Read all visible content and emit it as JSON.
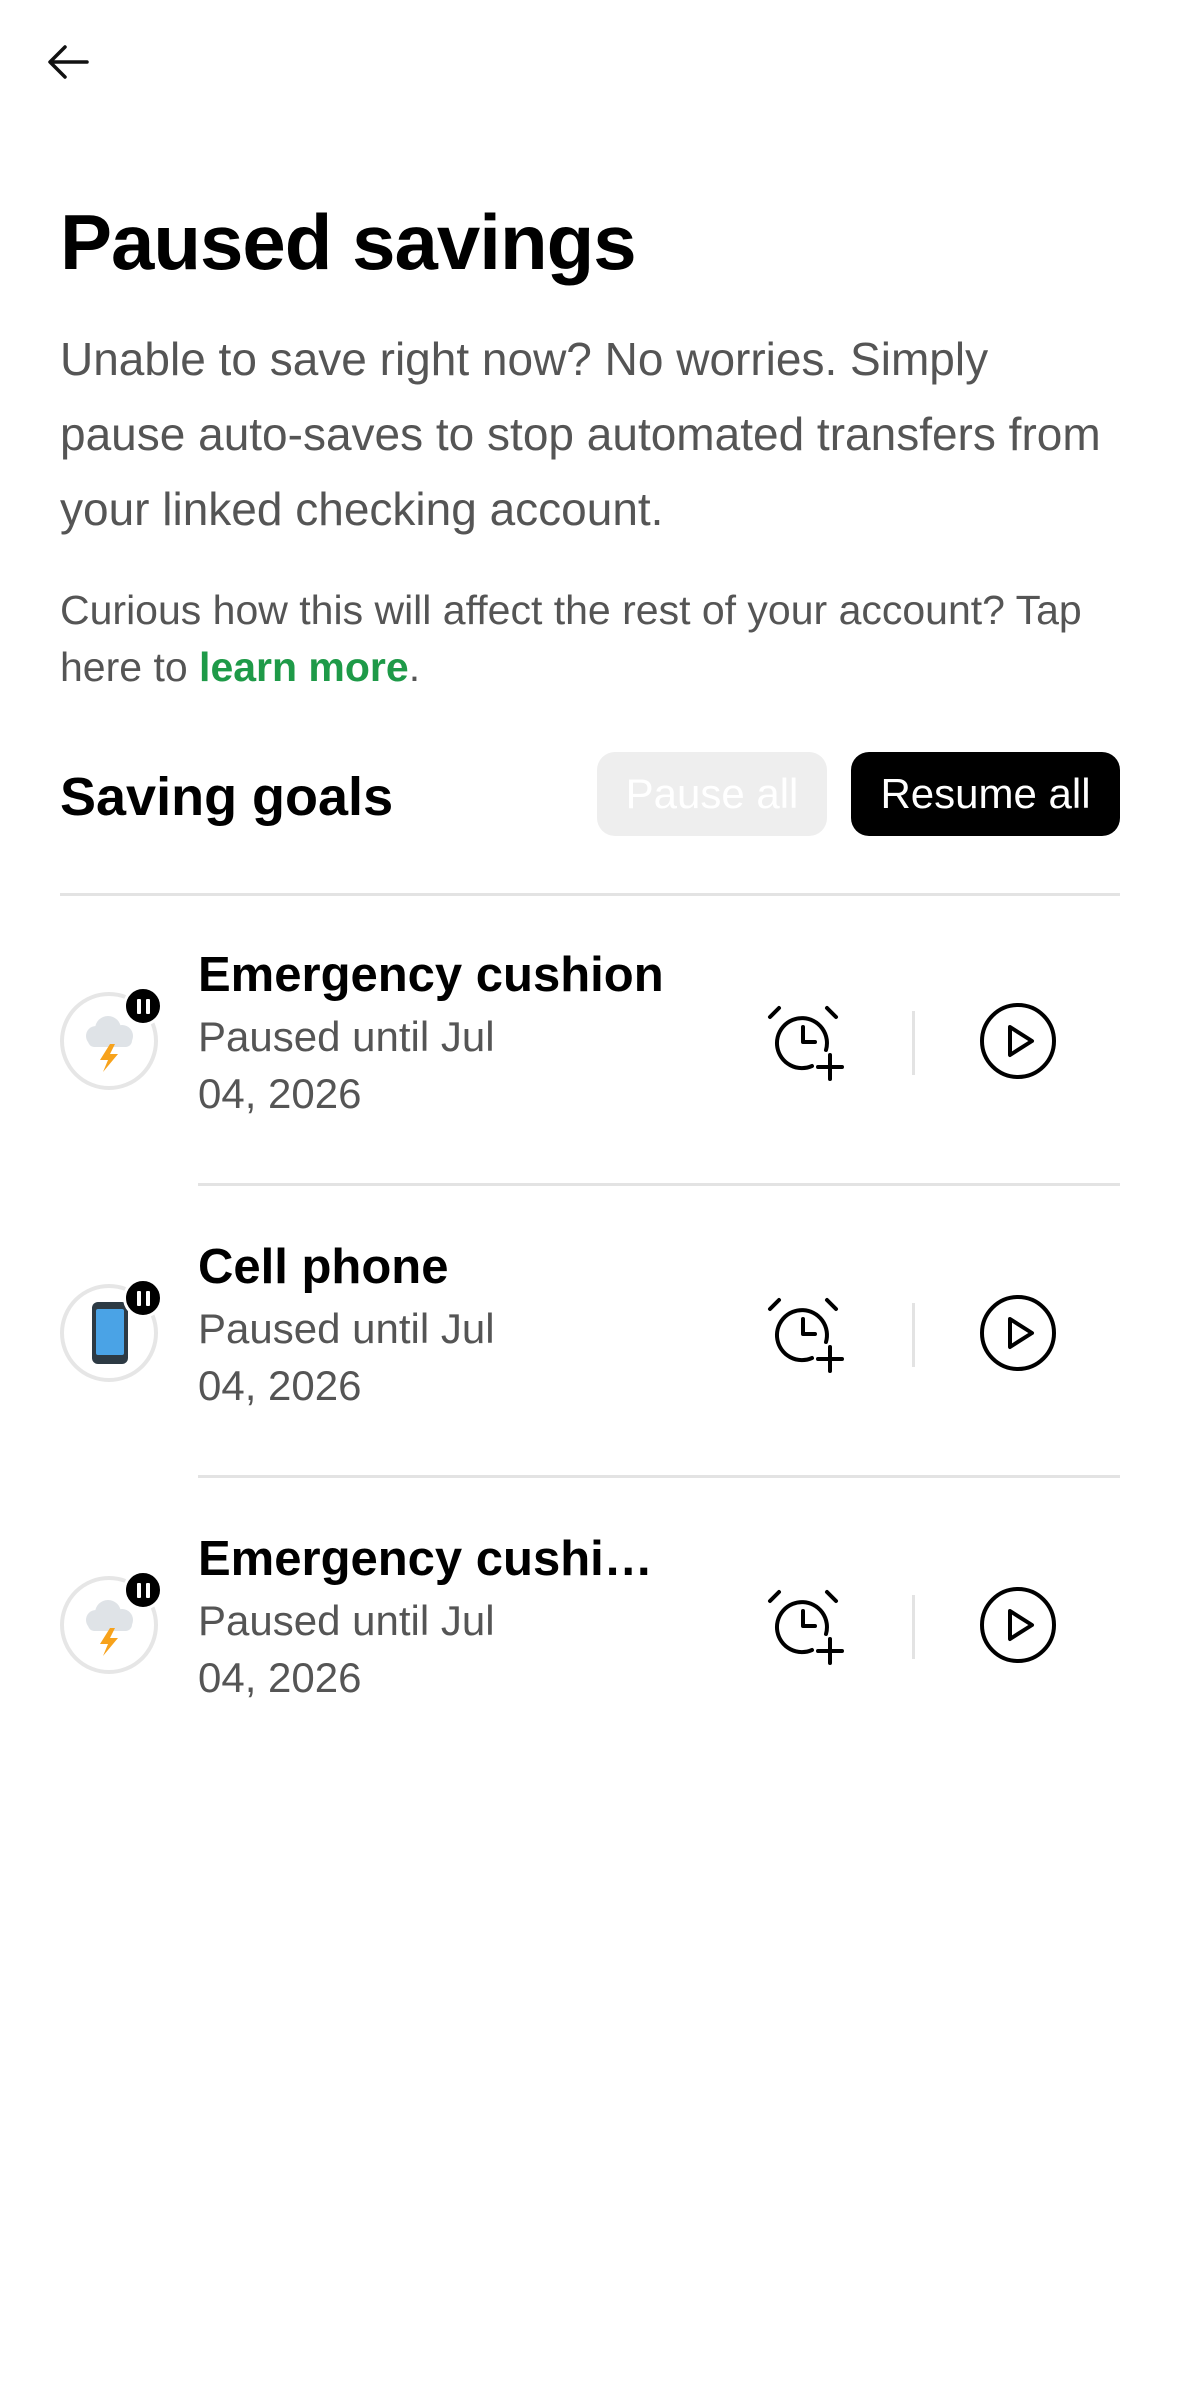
{
  "header": {
    "back_icon": "arrow-left-icon"
  },
  "page": {
    "title": "Paused savings",
    "intro": "Unable to save right now? No worries. Simply pause auto-saves to stop automated transfers from your linked checking account.",
    "info_prefix": "Curious how this will affect the rest of your account? Tap here to ",
    "info_link": "learn more",
    "info_suffix": "."
  },
  "section": {
    "title": "Saving goals",
    "pause_all_label": "Pause all",
    "resume_all_label": "Resume all"
  },
  "colors": {
    "link_green": "#1e9a48",
    "text_gray": "#555555",
    "divider": "#e3e3e3",
    "disabled_bg": "#eeeeee"
  },
  "goals": [
    {
      "name": "Emergency cushion",
      "status": "Paused until Jul 04, 2026",
      "icon": "storm-cloud-icon"
    },
    {
      "name": "Cell phone",
      "status": "Paused until Jul 04, 2026",
      "icon": "mobile-phone-icon"
    },
    {
      "name": "Emergency cushio...",
      "status": "Paused until Jul 04, 2026",
      "icon": "storm-cloud-icon"
    }
  ]
}
